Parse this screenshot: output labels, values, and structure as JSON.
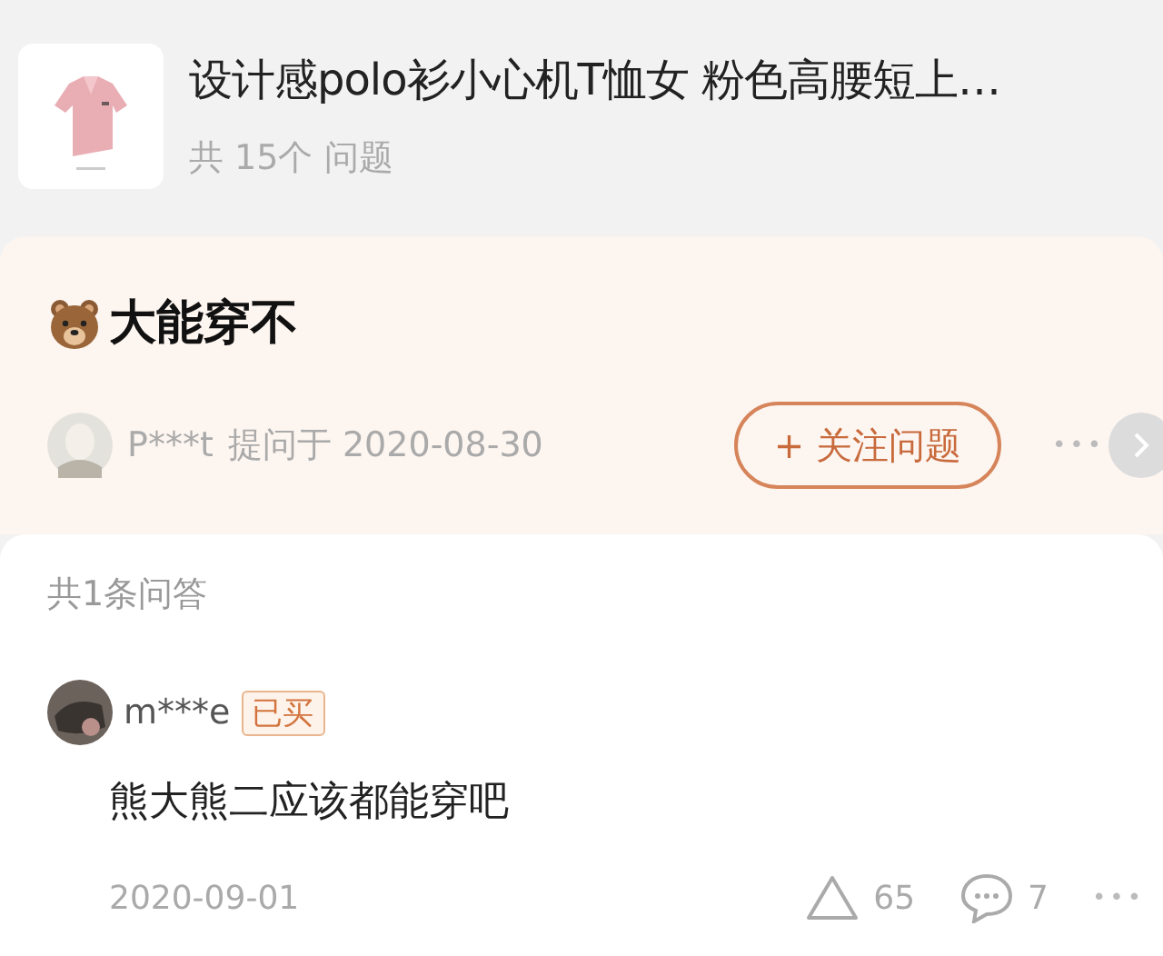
{
  "product": {
    "title": "设计感polo衫小心机T恤女 粉色高腰短上…",
    "question_count": "共 15个 问题"
  },
  "question": {
    "text": "大能穿不",
    "asker": "P***t",
    "asked_at": "提问于 2020-08-30",
    "follow_button": "+ 关注问题",
    "more": "•••"
  },
  "answers": {
    "count": "共1条问答",
    "items": [
      {
        "user": "m***e",
        "badge": "已买",
        "text": "熊大熊二应该都能穿吧",
        "date": "2020-09-01",
        "likes": "65",
        "comments": "7",
        "more": "•••"
      }
    ]
  }
}
